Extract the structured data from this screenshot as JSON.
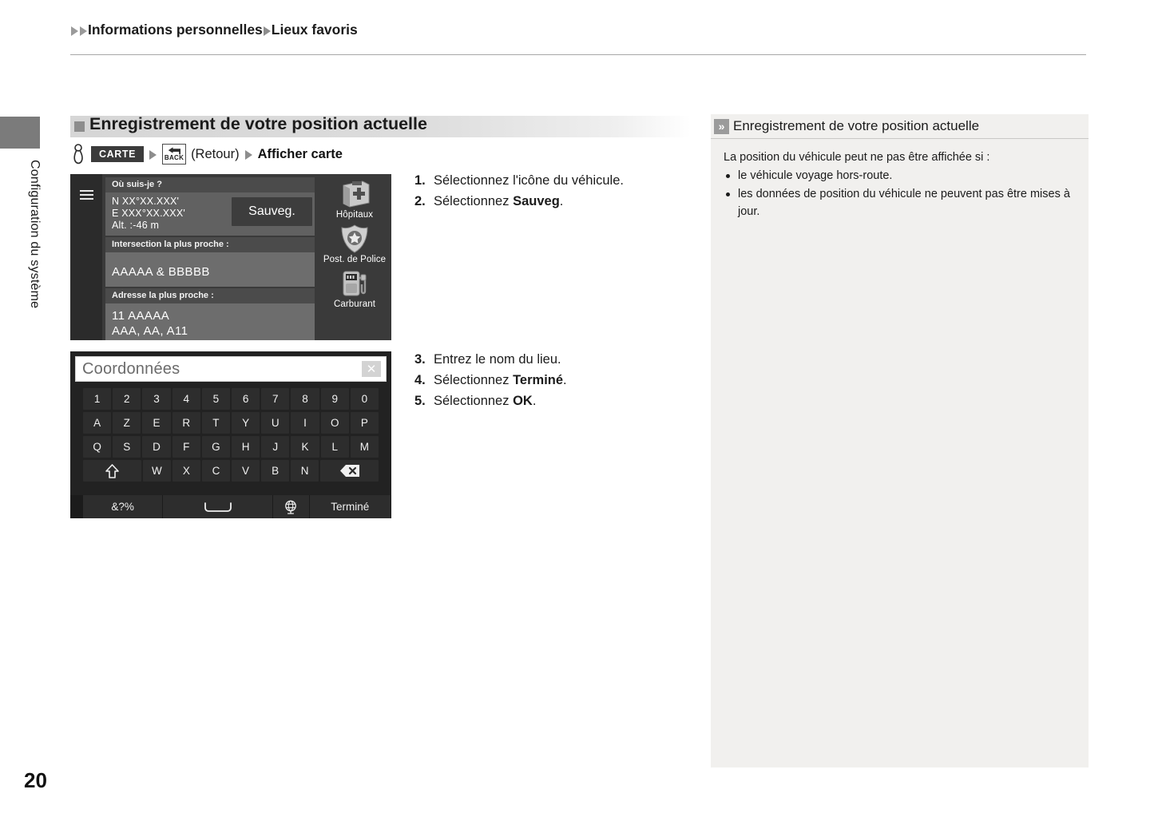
{
  "breadcrumb": {
    "part1": "Informations personnelles",
    "part2": "Lieux favoris"
  },
  "sidebar": {
    "tab_label": "Configuration du système"
  },
  "heading": {
    "title": "Enregistrement de votre position actuelle"
  },
  "path": {
    "hand_icon": "hand-pointer-icon",
    "map_button": "CARTE",
    "back_key_label": "BACK",
    "back_text": "(Retour)",
    "final": "Afficher carte"
  },
  "nav_screen": {
    "menu_icon": "hamburger-menu-icon",
    "header": "Où suis-je ?",
    "coords": {
      "lat": "N XX°XX.XXX'",
      "lon": "E XXX°XX.XXX'",
      "alt": "Alt. :-46 m"
    },
    "save_button": "Sauveg.",
    "intersection_header": "Intersection la plus proche :",
    "intersection_value": "AAAAA & BBBBB",
    "address_header": "Adresse la plus proche :",
    "address_line1": "11 AAAAA",
    "address_line2": "AAA, AA, A11",
    "icons": [
      {
        "icon": "hospital-icon",
        "label": "Hôpitaux"
      },
      {
        "icon": "police-badge-icon",
        "label": "Post. de Police"
      },
      {
        "icon": "fuel-pump-icon",
        "label": "Carburant"
      }
    ]
  },
  "keyboard_screen": {
    "input_value": "Coordonnées",
    "clear_icon": "clear-x-icon",
    "rows": [
      [
        "1",
        "2",
        "3",
        "4",
        "5",
        "6",
        "7",
        "8",
        "9",
        "0"
      ],
      [
        "A",
        "Z",
        "E",
        "R",
        "T",
        "Y",
        "U",
        "I",
        "O",
        "P"
      ],
      [
        "Q",
        "S",
        "D",
        "F",
        "G",
        "H",
        "J",
        "K",
        "L",
        "M"
      ]
    ],
    "row4": {
      "shift_icon": "shift-arrow-icon",
      "letters": [
        "W",
        "X",
        "C",
        "V",
        "B",
        "N"
      ],
      "backspace_icon": "backspace-icon"
    },
    "bottom": {
      "symbols": "&?%",
      "space_icon": "space-bar-icon",
      "globe_icon": "globe-language-icon",
      "done": "Terminé"
    }
  },
  "steps_group_a": [
    {
      "num": "1.",
      "pre": "Sélectionnez l'icône du véhicule.",
      "bold": "",
      "post": ""
    },
    {
      "num": "2.",
      "pre": "Sélectionnez ",
      "bold": "Sauveg",
      "post": "."
    }
  ],
  "steps_group_b": [
    {
      "num": "3.",
      "pre": "Entrez le nom du lieu.",
      "bold": "",
      "post": ""
    },
    {
      "num": "4.",
      "pre": "Sélectionnez ",
      "bold": "Terminé",
      "post": "."
    },
    {
      "num": "5.",
      "pre": "Sélectionnez ",
      "bold": "OK",
      "post": "."
    }
  ],
  "note": {
    "chevron_icon": "double-chevron-right-icon",
    "title": "Enregistrement de votre position actuelle",
    "intro": "La position du véhicule peut ne pas être affichée si :",
    "bullets": [
      "le véhicule voyage hors-route.",
      "les données de position du véhicule ne peuvent pas être mises à jour."
    ]
  },
  "page_number": "20",
  "colors": {
    "heading_bar": "#d6d6d6",
    "note_bg": "#f1f0ee",
    "nav_screen_bg": "#3a3a3a",
    "keyboard_bg": "#222222",
    "accent_gray": "#8d8d8d"
  }
}
